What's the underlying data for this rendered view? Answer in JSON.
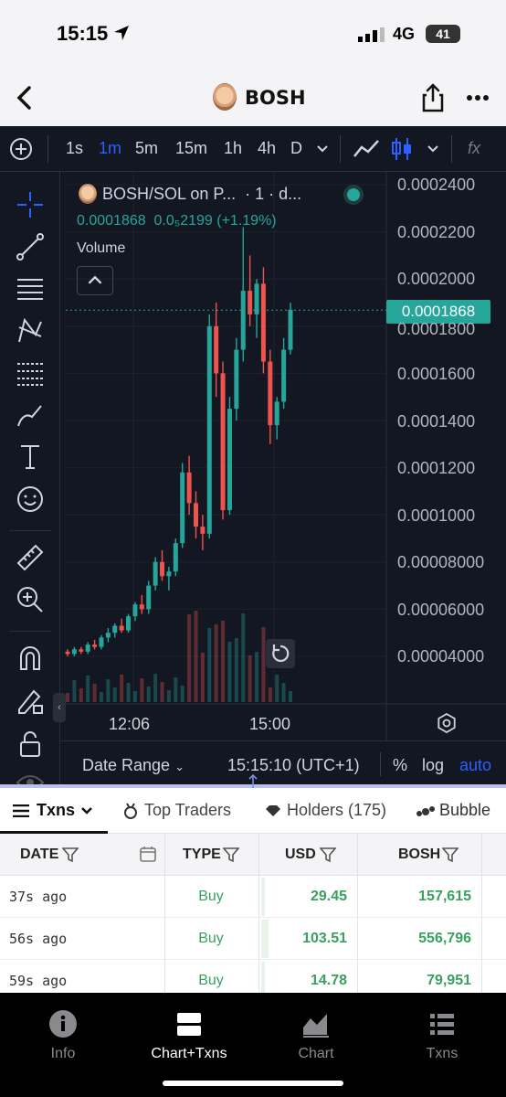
{
  "status": {
    "time": "15:15",
    "network": "4G",
    "battery": "41"
  },
  "nav": {
    "title": "BOSH"
  },
  "toolbar": {
    "intervals": [
      "1s",
      "1m",
      "5m",
      "15m",
      "1h",
      "4h",
      "D"
    ],
    "active_interval": "1m",
    "fx": "fx"
  },
  "legend": {
    "pair": "BOSH/SOL on P...",
    "suffix": "· 1 · d...",
    "price": "0.0001868",
    "change": "0.0₅2199 (+1.19%)",
    "volume_label": "Volume"
  },
  "price_axis": {
    "labels": [
      "0.0002400",
      "0.0002200",
      "0.0002000",
      "0.0001800",
      "0.0001600",
      "0.0001400",
      "0.0001200",
      "0.0001000",
      "0.00008000",
      "0.00006000",
      "0.00004000"
    ],
    "current": "0.0001868"
  },
  "time_axis": [
    "12:06",
    "15:00"
  ],
  "chart_footer": {
    "date_range": "Date Range",
    "clock": "15:15:10 (UTC+1)",
    "percent": "%",
    "log": "log",
    "auto": "auto"
  },
  "chart_data": {
    "type": "candlestick",
    "y_range": [
      2e-05,
      0.00025
    ],
    "current_price": 0.0001868,
    "x_ticks": [
      "12:06",
      "15:00"
    ],
    "candles_approx": [
      [
        4.2e-05,
        4.3e-05,
        4e-05,
        4.1e-05
      ],
      [
        4.1e-05,
        4.4e-05,
        4e-05,
        4.3e-05
      ],
      [
        4.3e-05,
        4.4e-05,
        4.1e-05,
        4.2e-05
      ],
      [
        4.2e-05,
        4.6e-05,
        4.1e-05,
        4.5e-05
      ],
      [
        4.5e-05,
        4.7e-05,
        4.3e-05,
        4.4e-05
      ],
      [
        4.4e-05,
        4.9e-05,
        4.3e-05,
        4.8e-05
      ],
      [
        4.8e-05,
        5.2e-05,
        4.6e-05,
        5e-05
      ],
      [
        5e-05,
        5.4e-05,
        4.8e-05,
        5.3e-05
      ],
      [
        5.3e-05,
        5.6e-05,
        5e-05,
        5.1e-05
      ],
      [
        5.1e-05,
        5.8e-05,
        5e-05,
        5.7e-05
      ],
      [
        5.7e-05,
        6.3e-05,
        5.5e-05,
        6.2e-05
      ],
      [
        6.2e-05,
        6.6e-05,
        5.8e-05,
        6e-05
      ],
      [
        6e-05,
        7.2e-05,
        5.8e-05,
        7e-05
      ],
      [
        7e-05,
        8.2e-05,
        6.8e-05,
        8e-05
      ],
      [
        8e-05,
        8.5e-05,
        7.2e-05,
        7.4e-05
      ],
      [
        7.4e-05,
        7.8e-05,
        6.8e-05,
        7.6e-05
      ],
      [
        7.6e-05,
        9e-05,
        7.4e-05,
        8.8e-05
      ],
      [
        8.8e-05,
        0.000122,
        8.6e-05,
        0.000118
      ],
      [
        0.000118,
        0.000125,
        0.0001,
        0.000105
      ],
      [
        0.000105,
        0.00011,
        9e-05,
        9.5e-05
      ],
      [
        9.5e-05,
        0.0001,
        8.5e-05,
        9.2e-05
      ],
      [
        9.2e-05,
        0.000185,
        9e-05,
        0.00018
      ],
      [
        0.00018,
        0.00019,
        0.00015,
        0.00016
      ],
      [
        0.00016,
        0.000165,
        9.8e-05,
        0.000102
      ],
      [
        0.000102,
        0.00015,
        0.0001,
        0.000145
      ],
      [
        0.000145,
        0.000175,
        0.00014,
        0.00017
      ],
      [
        0.00017,
        0.000222,
        0.000165,
        0.000195
      ],
      [
        0.000195,
        0.00021,
        0.00018,
        0.000185
      ],
      [
        0.000185,
        0.0002,
        0.000175,
        0.000198
      ],
      [
        0.000198,
        0.000205,
        0.00016,
        0.000165
      ],
      [
        0.000165,
        0.00017,
        0.00013,
        0.000138
      ],
      [
        0.000138,
        0.00015,
        0.000132,
        0.000148
      ],
      [
        0.000148,
        0.000175,
        0.000145,
        0.00017
      ],
      [
        0.00017,
        0.00019,
        0.000168,
        0.000187
      ]
    ]
  },
  "tabs": [
    {
      "label": "Txns"
    },
    {
      "label": "Top Traders"
    },
    {
      "label": "Holders (175)"
    },
    {
      "label": "Bubble"
    }
  ],
  "table": {
    "headers": [
      "DATE",
      "TYPE",
      "USD",
      "BOSH"
    ],
    "rows": [
      {
        "age": "37s ago",
        "type": "Buy",
        "usd": "29.45",
        "bosh": "157,615",
        "usd_fill": 0.03
      },
      {
        "age": "56s ago",
        "type": "Buy",
        "usd": "103.51",
        "bosh": "556,796",
        "usd_fill": 0.08
      },
      {
        "age": "59s ago",
        "type": "Buy",
        "usd": "14.78",
        "bosh": "79,951",
        "usd_fill": 0.02
      }
    ]
  },
  "bottom_nav": [
    {
      "label": "Info",
      "icon": "info-icon"
    },
    {
      "label": "Chart+Txns",
      "icon": "chart-txns-icon",
      "active": true
    },
    {
      "label": "Chart",
      "icon": "area-chart-icon"
    },
    {
      "label": "Txns",
      "icon": "list-icon"
    }
  ],
  "colors": {
    "up": "#26a69a",
    "down": "#ef5350",
    "chart_bg": "#131722",
    "accent": "#2962ff",
    "buy": "#3aa060"
  }
}
